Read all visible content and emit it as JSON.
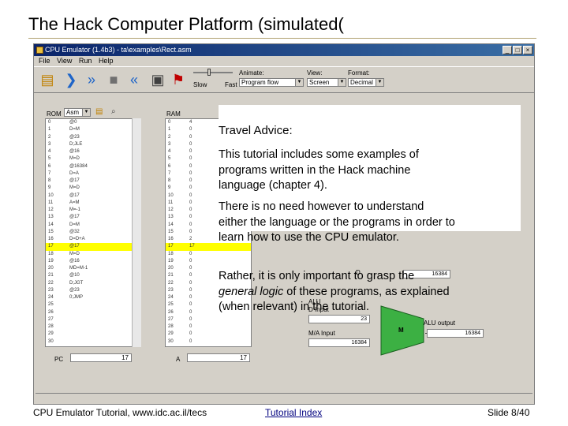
{
  "slide": {
    "title": "The Hack Computer Platform (simulated(",
    "footer_left": "CPU Emulator Tutorial, www.idc.ac.il/tecs",
    "footer_link": "Tutorial Index",
    "footer_right": "Slide 8/40"
  },
  "app": {
    "title": "CPU Emulator (1.4b3) - ta\\examples\\Rect.asm",
    "menu": [
      "File",
      "View",
      "Run",
      "Help"
    ],
    "controls": {
      "animate_label": "Animate:",
      "animate_value": "Program flow",
      "view_label": "View:",
      "view_value": "Screen",
      "format_label": "Format:",
      "format_value": "Decimal",
      "slow_label": "Slow",
      "fast_label": "Fast"
    },
    "rom": {
      "label": "ROM",
      "format": "Asm",
      "rows": [
        [
          "0",
          "@0"
        ],
        [
          "1",
          "D=M"
        ],
        [
          "2",
          "@23"
        ],
        [
          "3",
          "D;JLE"
        ],
        [
          "4",
          "@16"
        ],
        [
          "5",
          "M=D"
        ],
        [
          "6",
          "@16384"
        ],
        [
          "7",
          "D=A"
        ],
        [
          "8",
          "@17"
        ],
        [
          "9",
          "M=D"
        ],
        [
          "10",
          "@17"
        ],
        [
          "11",
          "A=M"
        ],
        [
          "12",
          "M=-1"
        ],
        [
          "13",
          "@17"
        ],
        [
          "14",
          "D=M"
        ],
        [
          "15",
          "@32"
        ],
        [
          "16",
          "D=D+A"
        ],
        [
          "17",
          "@17"
        ],
        [
          "18",
          "M=D"
        ],
        [
          "19",
          "@16"
        ],
        [
          "20",
          "MD=M-1"
        ],
        [
          "21",
          "@10"
        ],
        [
          "22",
          "D;JGT"
        ],
        [
          "23",
          "@23"
        ],
        [
          "24",
          "0;JMP"
        ],
        [
          "25",
          ""
        ],
        [
          "26",
          ""
        ],
        [
          "27",
          ""
        ],
        [
          "28",
          ""
        ],
        [
          "29",
          ""
        ],
        [
          "30",
          ""
        ]
      ],
      "pc_label": "PC",
      "pc_value": "17"
    },
    "ram": {
      "label": "RAM",
      "rows": [
        [
          "0",
          "4"
        ],
        [
          "1",
          "0"
        ],
        [
          "2",
          "0"
        ],
        [
          "3",
          "0"
        ],
        [
          "4",
          "0"
        ],
        [
          "5",
          "0"
        ],
        [
          "6",
          "0"
        ],
        [
          "7",
          "0"
        ],
        [
          "8",
          "0"
        ],
        [
          "9",
          "0"
        ],
        [
          "10",
          "0"
        ],
        [
          "11",
          "0"
        ],
        [
          "12",
          "0"
        ],
        [
          "13",
          "0"
        ],
        [
          "14",
          "0"
        ],
        [
          "15",
          "0"
        ],
        [
          "16",
          "2"
        ],
        [
          "17",
          "17"
        ],
        [
          "18",
          "0"
        ],
        [
          "19",
          "0"
        ],
        [
          "20",
          "0"
        ],
        [
          "21",
          "0"
        ],
        [
          "22",
          "0"
        ],
        [
          "23",
          "0"
        ],
        [
          "24",
          "0"
        ],
        [
          "25",
          "0"
        ],
        [
          "26",
          "0"
        ],
        [
          "27",
          "0"
        ],
        [
          "28",
          "0"
        ],
        [
          "29",
          "0"
        ],
        [
          "30",
          "0"
        ]
      ],
      "a_label": "A",
      "a_value": "17"
    },
    "alu": {
      "label": "ALU",
      "d_label": "D",
      "d_input": "D Input",
      "d_value": "23",
      "m_input": "M/A Input",
      "m_value": "16384",
      "output_label": "ALU output",
      "output_value": "16384",
      "op": "M",
      "top_value": "16384"
    }
  },
  "advice": {
    "title": "Travel Advice:",
    "p1": "This tutorial includes some examples of programs written in the Hack machine language (chapter 4).",
    "p2": "There is no need however to understand either the language or the programs in order to learn how to use the CPU emulator.",
    "p3_pre": "Rather, it is only important to grasp the",
    "p3_em": "general logic",
    "p3_post": "of these programs, as explained (when relevant) in the tutorial."
  },
  "colors": {
    "highlight": "#ffff00",
    "alu": "#3cb043",
    "titlebar": "#0a246a"
  }
}
